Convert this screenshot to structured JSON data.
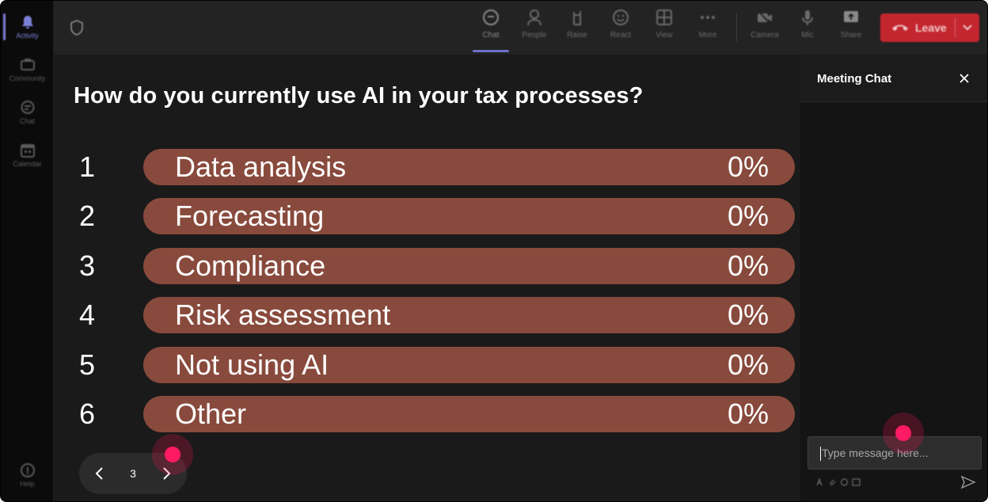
{
  "rail": {
    "items": [
      {
        "label": "Activity",
        "icon": "bell-icon",
        "active": true
      },
      {
        "label": "Community",
        "icon": "community-icon"
      },
      {
        "label": "Chat",
        "icon": "chat-icon"
      },
      {
        "label": "Calendar",
        "icon": "calendar-icon"
      }
    ],
    "help_label": "Help"
  },
  "toolbar": {
    "chat": "Chat",
    "people": "People",
    "raise": "Raise",
    "react": "React",
    "view": "View",
    "more": "More",
    "camera": "Camera",
    "mic": "Mic",
    "share": "Share",
    "leave": "Leave"
  },
  "poll": {
    "question": "How do you currently use AI in your tax processes?",
    "options": [
      {
        "num": "1",
        "label": "Data analysis",
        "pct": "0%"
      },
      {
        "num": "2",
        "label": "Forecasting",
        "pct": "0%"
      },
      {
        "num": "3",
        "label": "Compliance",
        "pct": "0%"
      },
      {
        "num": "4",
        "label": "Risk assessment",
        "pct": "0%"
      },
      {
        "num": "5",
        "label": "Not using AI",
        "pct": "0%"
      },
      {
        "num": "6",
        "label": "Other",
        "pct": "0%"
      }
    ],
    "bar_color": "#884a3c"
  },
  "pager": {
    "page": "3"
  },
  "chat": {
    "title": "Meeting Chat",
    "input_placeholder": "Type message here..."
  },
  "colors": {
    "accent": "#7d80d8",
    "leave": "#c4262f",
    "cursor": "#ff1a66"
  }
}
